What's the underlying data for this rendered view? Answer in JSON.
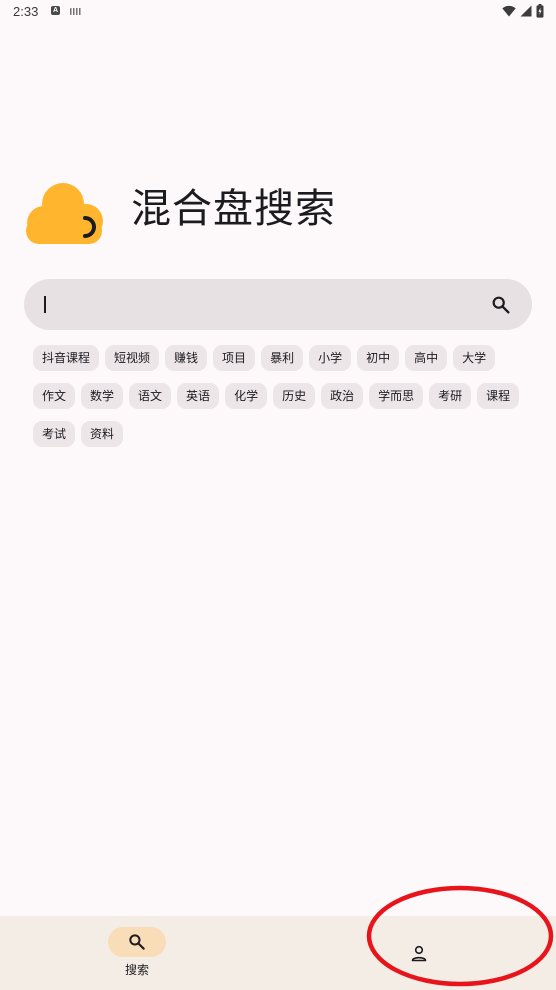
{
  "status_bar": {
    "time": "2:33",
    "left_icons": [
      "a-icon",
      "keyboard-icon"
    ],
    "right_icons": [
      "wifi-icon",
      "signal-icon",
      "battery-icon"
    ]
  },
  "app": {
    "title": "混合盘搜索",
    "logo_icon": "cloud-icon",
    "accent_color": "#FFB62E"
  },
  "search": {
    "value": "",
    "placeholder": "",
    "button_icon": "search-icon"
  },
  "chips": [
    "抖音课程",
    "短视频",
    "赚钱",
    "项目",
    "暴利",
    "小学",
    "初中",
    "高中",
    "大学",
    "作文",
    "数学",
    "语文",
    "英语",
    "化学",
    "历史",
    "政治",
    "学而思",
    "考研",
    "课程",
    "考试",
    "资料"
  ],
  "bottom_nav": {
    "items": [
      {
        "label": "搜索",
        "icon": "search-icon",
        "selected": true
      },
      {
        "label": "",
        "icon": "person-icon",
        "selected": false
      }
    ]
  },
  "annotation": {
    "shape": "ellipse",
    "color": "#E8141B",
    "target": "person-icon"
  }
}
